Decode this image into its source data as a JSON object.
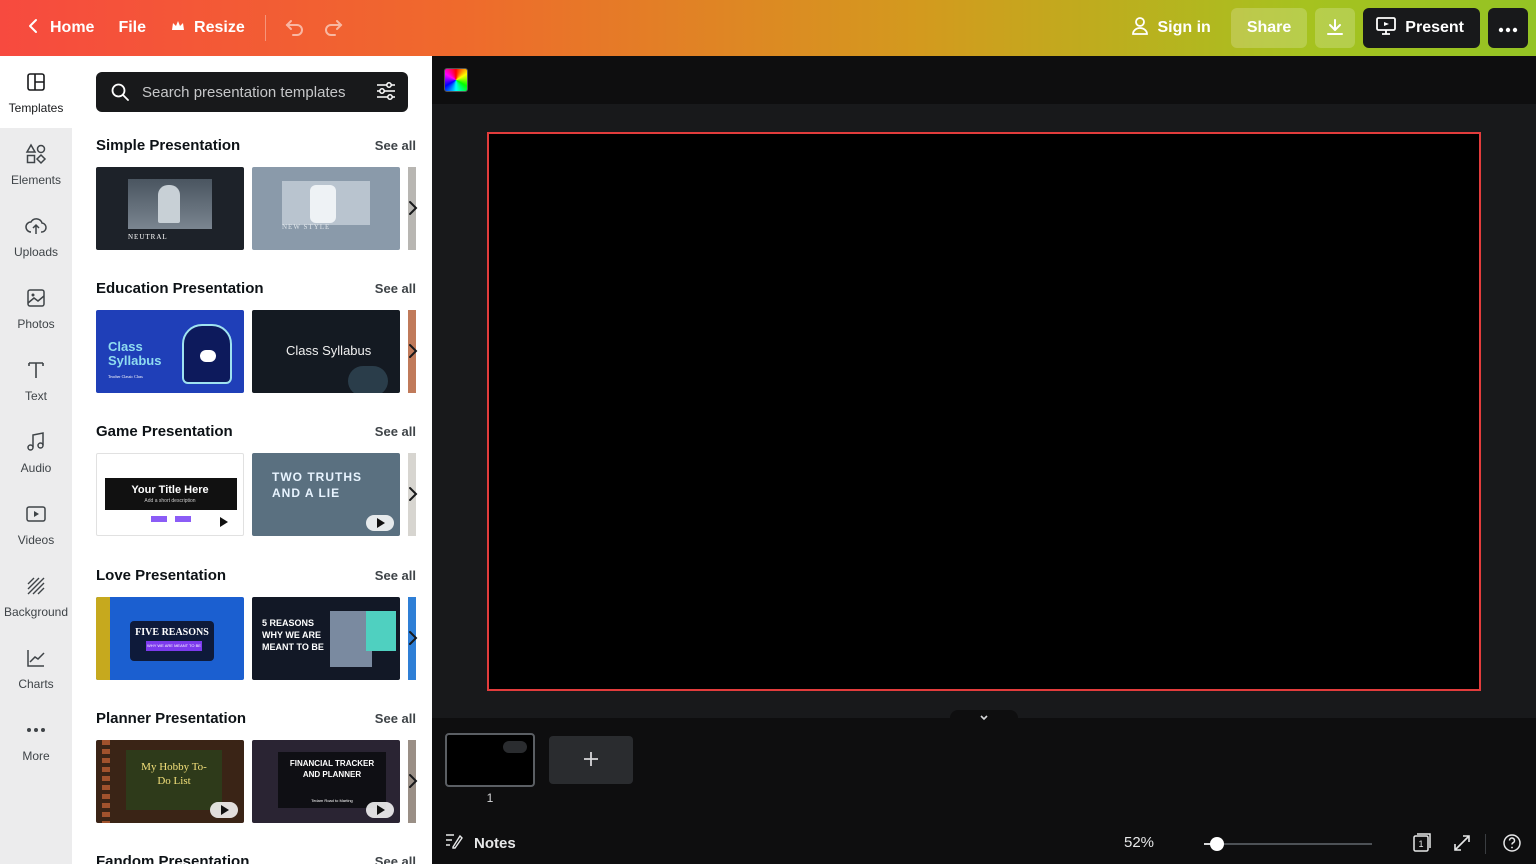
{
  "topbar": {
    "home_label": "Home",
    "file_label": "File",
    "resize_label": "Resize",
    "signin_label": "Sign in",
    "share_label": "Share",
    "present_label": "Present",
    "icons": [
      "chevron-left-icon",
      "crown-icon",
      "undo-icon",
      "redo-icon",
      "user-icon",
      "download-icon",
      "present-icon",
      "more-dots-icon"
    ]
  },
  "rail": {
    "items": [
      {
        "label": "Templates",
        "icon": "templates-icon",
        "active": true
      },
      {
        "label": "Elements",
        "icon": "elements-icon"
      },
      {
        "label": "Uploads",
        "icon": "upload-cloud-icon"
      },
      {
        "label": "Photos",
        "icon": "photo-icon"
      },
      {
        "label": "Text",
        "icon": "text-icon"
      },
      {
        "label": "Audio",
        "icon": "music-note-icon"
      },
      {
        "label": "Videos",
        "icon": "video-icon"
      },
      {
        "label": "Background",
        "icon": "background-pattern-icon"
      },
      {
        "label": "Charts",
        "icon": "chart-line-icon"
      },
      {
        "label": "More",
        "icon": "more-dots-icon"
      }
    ]
  },
  "panel": {
    "search_placeholder": "Search presentation templates",
    "see_all": "See all",
    "sections": [
      {
        "title": "Simple Presentation",
        "thumbs": [
          {
            "text": "NEUTRAL"
          },
          {
            "text": "NEW STYLE"
          }
        ]
      },
      {
        "title": "Education Presentation",
        "thumbs": [
          {
            "text": "Class Syllabus",
            "sub": "Teacher Classic Class"
          },
          {
            "text": "Class Syllabus"
          }
        ]
      },
      {
        "title": "Game Presentation",
        "thumbs": [
          {
            "text": "Your Title Here",
            "sub": "Add a short description"
          },
          {
            "text": "TWO TRUTHS AND A LIE"
          }
        ]
      },
      {
        "title": "Love Presentation",
        "thumbs": [
          {
            "text": "FIVE REASONS",
            "sub": "WHY WE ARE MEANT TO BE"
          },
          {
            "text": "5 REASONS WHY WE ARE MEANT TO BE"
          }
        ]
      },
      {
        "title": "Planner Presentation",
        "thumbs": [
          {
            "text": "My Hobby To-Do List"
          },
          {
            "text": "FINANCIAL TRACKER AND PLANNER",
            "sub": "Tedam Road to Marting"
          }
        ]
      },
      {
        "title": "Fandom Presentation"
      }
    ]
  },
  "editor": {
    "page_number": "1",
    "notes_label": "Notes",
    "zoom_label": "52%",
    "zoom_fraction": 0.08,
    "colors": {
      "page_border": "#e23c3c",
      "page_bg": "#000000"
    }
  }
}
